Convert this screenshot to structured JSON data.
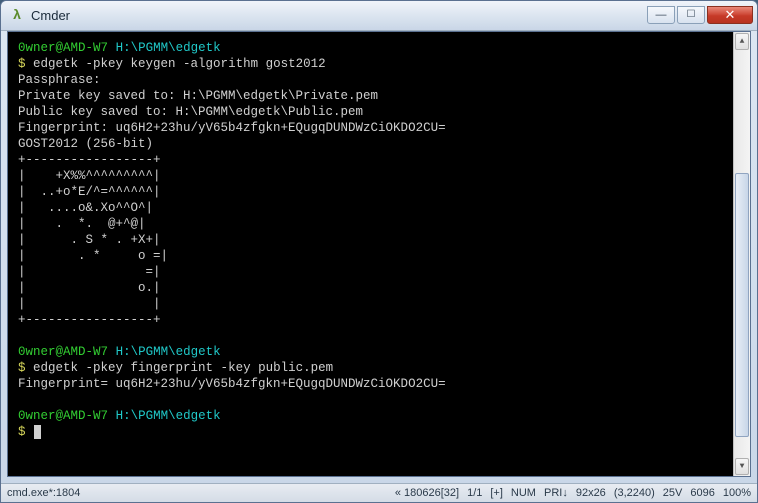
{
  "window": {
    "title": "Cmder",
    "icon_label": "λ"
  },
  "prompt": {
    "user": "0wner",
    "host": "AMD-W7",
    "path": "H:\\PGMM\\edgetk",
    "symbol": "$"
  },
  "session": {
    "cmd1": "edgetk -pkey keygen -algorithm gost2012",
    "out1_l1": "Passphrase:",
    "out1_l2": "Private key saved to: H:\\PGMM\\edgetk\\Private.pem",
    "out1_l3": "Public key saved to: H:\\PGMM\\edgetk\\Public.pem",
    "out1_l4": "Fingerprint: uq6H2+23hu/yV65b4zfgkn+EQugqDUNDWzCiOKDO2CU=",
    "out1_l5": "GOST2012 (256-bit)",
    "art_l0": "+-----------------+",
    "art_l1": "|    +X%%^^^^^^^^^|",
    "art_l2": "|  ..+o*E/^=^^^^^^|",
    "art_l3": "|   ....o&.Xo^^O^|",
    "art_l4": "|    .  *.  @+^@|",
    "art_l5": "|      . S * . +X+|",
    "art_l6": "|       . *     o =|",
    "art_l7": "|                =|",
    "art_l8": "|               o.|",
    "art_l9": "|                 |",
    "art_l10": "+-----------------+",
    "cmd2": "edgetk -pkey fingerprint -key public.pem",
    "out2_l1": "Fingerprint= uq6H2+23hu/yV65b4zfgkn+EQugqDUNDWzCiOKDO2CU="
  },
  "status": {
    "process": "cmd.exe*:1804",
    "block1": "« 180626[32]",
    "block2": "1/1",
    "block3": "[+]",
    "num": "NUM",
    "pri": "PRI↓",
    "size": "92x26",
    "pos": "(3,2240)",
    "vt": "25V",
    "mem": "6096",
    "pct": "100%"
  }
}
